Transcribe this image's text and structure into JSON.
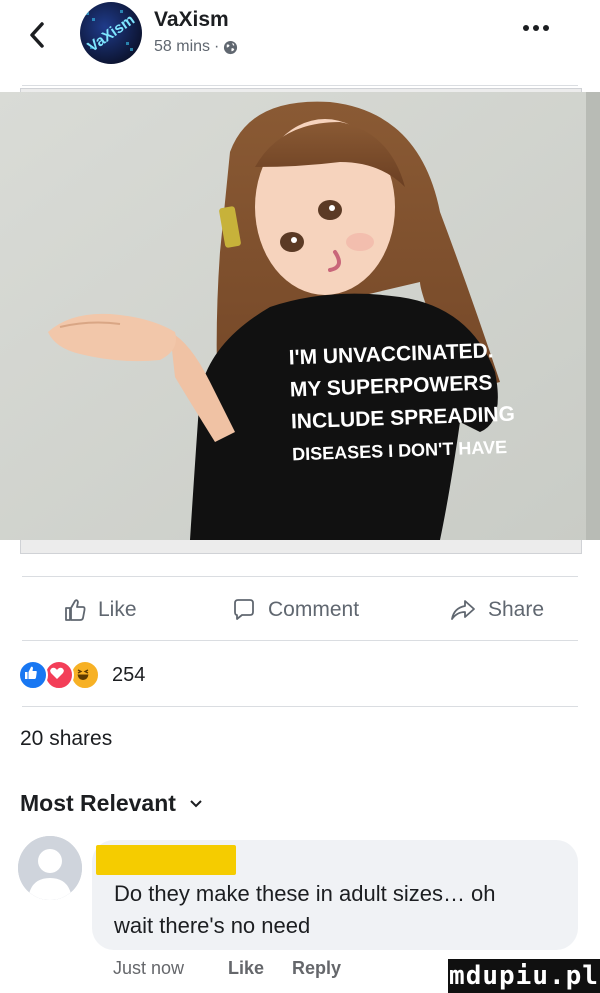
{
  "header": {
    "page_name": "VaXism",
    "timestamp": "58 mins",
    "separator": "·",
    "avatar_text": "VaXism",
    "icons": {
      "back": "chevron-left-icon",
      "privacy": "globe-icon",
      "more": "more-dots-icon"
    }
  },
  "post": {
    "shirt_text": [
      "I'M UNVACCINATED.",
      "MY SUPERPOWERS",
      "INCLUDE SPREADING",
      "DISEASES I DON'T HAVE"
    ]
  },
  "actions": {
    "like_label": "Like",
    "comment_label": "Comment",
    "share_label": "Share"
  },
  "reactions": {
    "count": "254",
    "types": [
      "like",
      "love",
      "haha"
    ],
    "colors": {
      "like": "#1877f2",
      "love": "#f33e58",
      "haha": "#f7b125"
    }
  },
  "shares_text": "20 shares",
  "comments": {
    "sort_label": "Most Relevant",
    "items": [
      {
        "line1": "Do they make these in adult sizes… oh",
        "line2": "wait there's no need",
        "time": "Just now",
        "like_label": "Like",
        "reply_label": "Reply"
      }
    ]
  },
  "watermark": "mdupiu.pl"
}
